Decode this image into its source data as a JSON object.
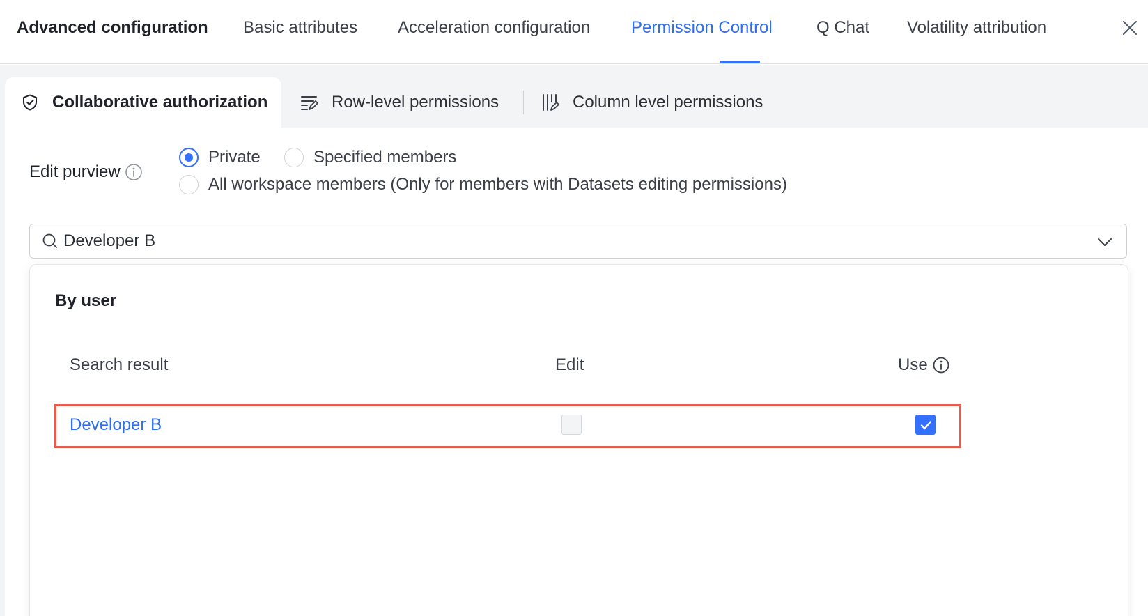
{
  "header": {
    "title": "Advanced configuration",
    "tabs": [
      {
        "label": "Basic attributes",
        "active": false
      },
      {
        "label": "Acceleration configuration",
        "active": false
      },
      {
        "label": "Permission Control",
        "active": true
      },
      {
        "label": "Q Chat",
        "active": false
      },
      {
        "label": "Volatility attribution",
        "active": false
      }
    ],
    "close_icon": "close-icon"
  },
  "subtabs": [
    {
      "label": "Collaborative authorization",
      "icon": "shield-check-icon",
      "active": true
    },
    {
      "label": "Row-level permissions",
      "icon": "row-filter-icon",
      "active": false
    },
    {
      "label": "Column level permissions",
      "icon": "column-filter-icon",
      "active": false
    }
  ],
  "purview": {
    "label": "Edit purview",
    "options": [
      {
        "label": "Private",
        "checked": true
      },
      {
        "label": "Specified members",
        "checked": false
      },
      {
        "label": "All workspace members (Only for members with Datasets editing permissions)",
        "checked": false
      }
    ]
  },
  "search": {
    "value": "Developer B",
    "placeholder": ""
  },
  "dropdown": {
    "section_title": "By user",
    "columns": [
      "Search result",
      "Edit",
      "Use"
    ],
    "rows": [
      {
        "name": "Developer B",
        "edit": false,
        "edit_disabled": true,
        "use": true
      }
    ]
  },
  "colors": {
    "accent": "#3370ff",
    "highlight_border": "#e85c4e",
    "panel_bg": "#f3f4f6"
  }
}
